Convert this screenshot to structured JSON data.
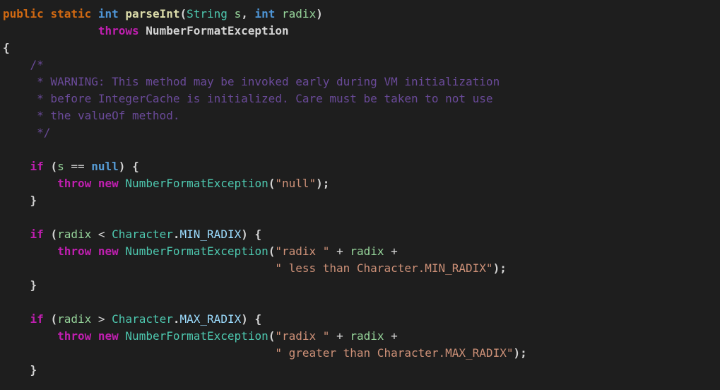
{
  "code": {
    "sig": {
      "mod1": "public",
      "mod2": "static",
      "ret": "int",
      "name": "parseInt",
      "ptype1": "String",
      "pname1": "s",
      "ptype2": "int",
      "pname2": "radix",
      "throws_kw": "throws",
      "throws_cls": "NumberFormatException"
    },
    "brace_open": "{",
    "brace_close": "}",
    "comment": {
      "l1": "/*",
      "l2": " * WARNING: This method may be invoked early during VM initialization",
      "l3": " * before IntegerCache is initialized. Care must be taken to not use",
      "l4": " * the valueOf method.",
      "l5": " */"
    },
    "if_kw": "if",
    "throw_kw": "throw",
    "new_kw": "new",
    "nfe": "NumberFormatException",
    "eqeq": "==",
    "nullkw": "null",
    "lt": "<",
    "gt": ">",
    "plus": "+",
    "s_var": "s",
    "radix_var": "radix",
    "char_cls": "Character",
    "min_radix": "MIN_RADIX",
    "max_radix": "MAX_RADIX",
    "str_null": "\"null\"",
    "str_radix_sp": "\"radix \"",
    "str_less": "\" less than Character.MIN_RADIX\"",
    "str_greater": "\" greater than Character.MAX_RADIX\""
  }
}
